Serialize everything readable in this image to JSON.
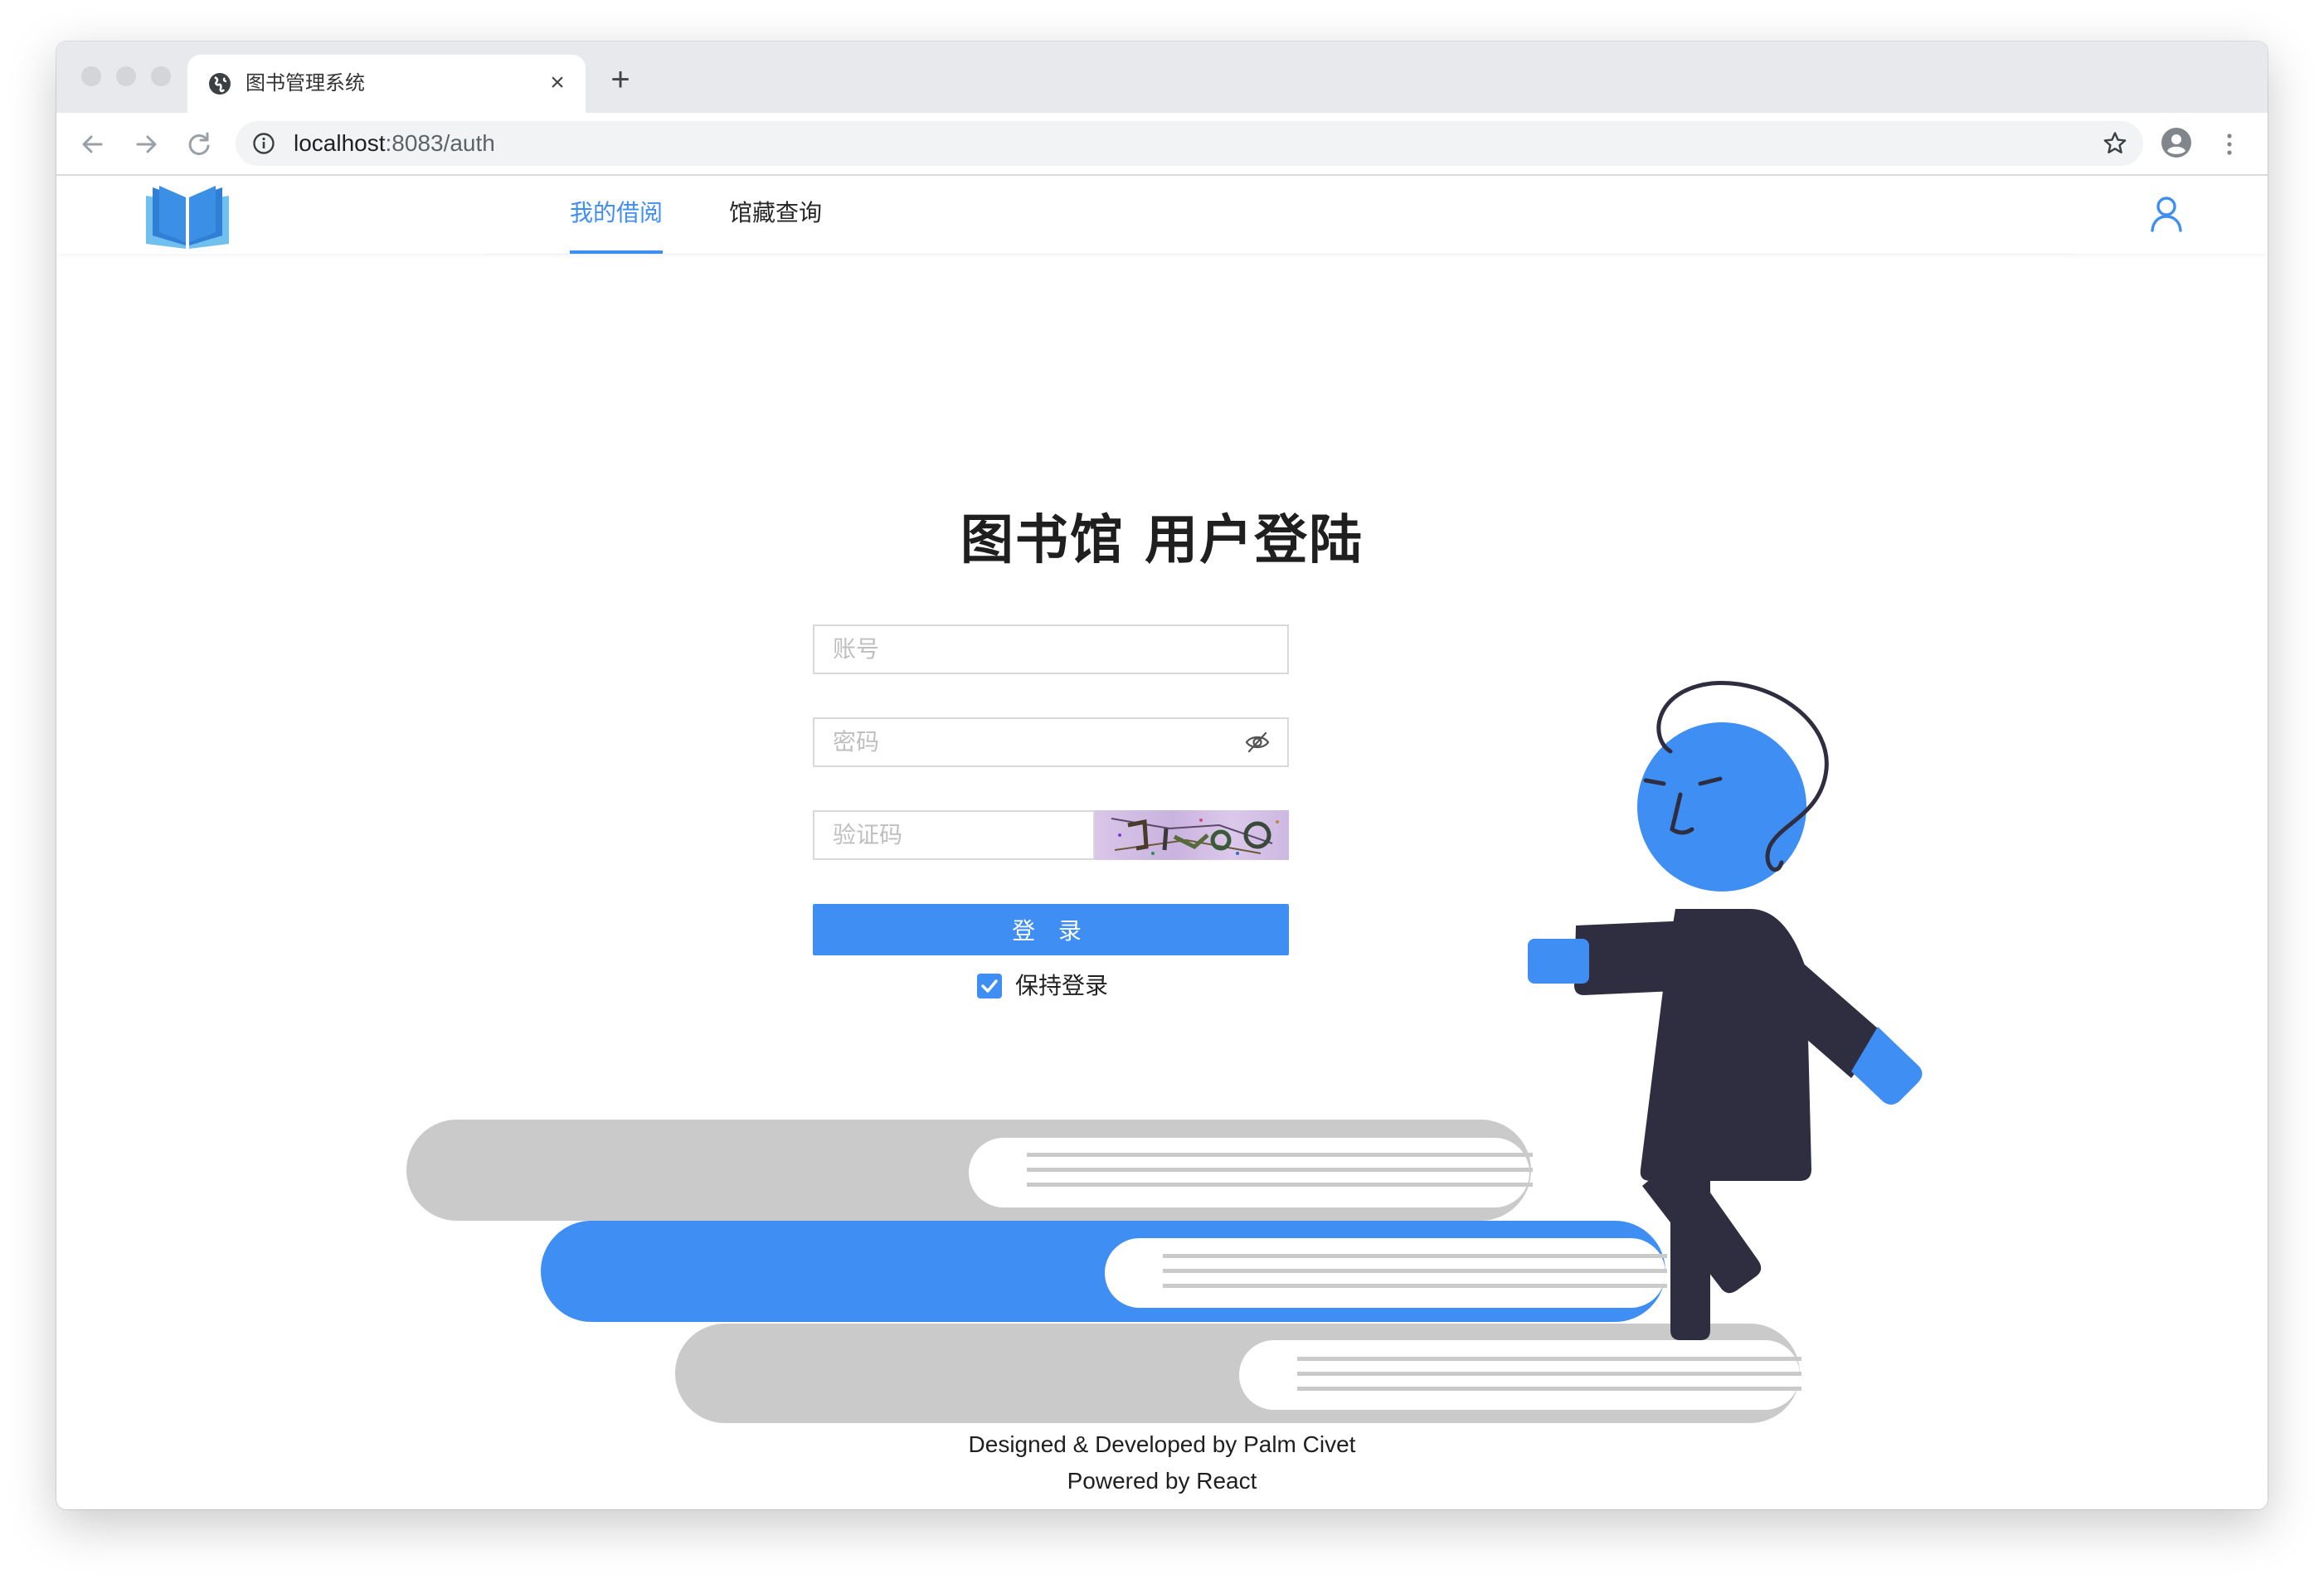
{
  "browser": {
    "tab_title": "图书管理系统",
    "tab_close": "×",
    "new_tab": "+",
    "url_host": "localhost",
    "url_rest": ":8083/auth"
  },
  "header": {
    "nav": [
      {
        "label": "我的借阅",
        "active": true
      },
      {
        "label": "馆藏查询",
        "active": false
      }
    ]
  },
  "login": {
    "title": "图书馆 用户登陆",
    "account_placeholder": "账号",
    "password_placeholder": "密码",
    "captcha_placeholder": "验证码",
    "submit_label": "登 录",
    "remember_label": "保持登录",
    "remember_checked": true
  },
  "footer": {
    "line1": "Designed & Developed by Palm Civet",
    "line2": "Powered by React"
  },
  "colors": {
    "accent": "#3f8ef3",
    "figure_dark": "#2f2e41",
    "book_gray": "#cacaca"
  }
}
